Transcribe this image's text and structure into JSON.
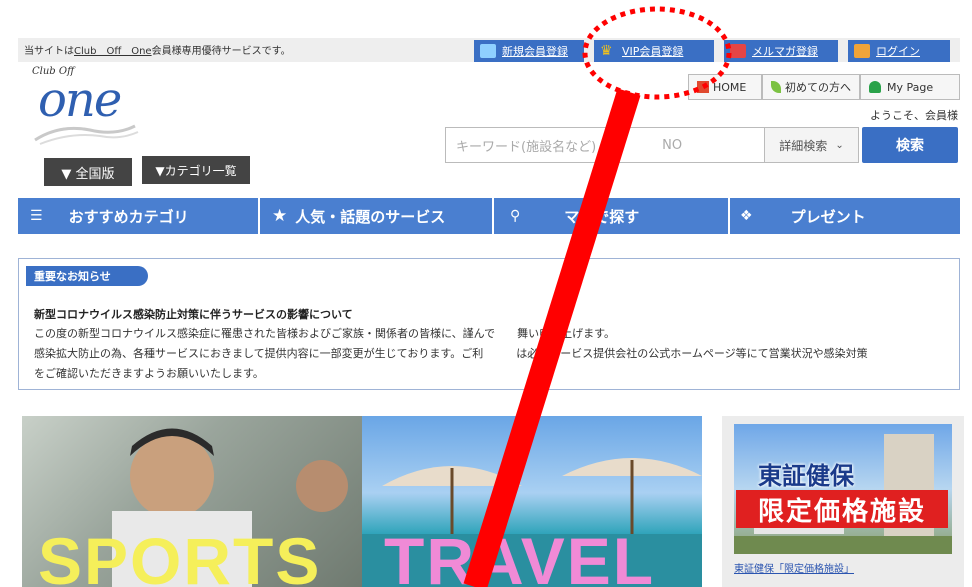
{
  "top": {
    "note_prefix": "当サイトは",
    "note_link": "Club　Off　One",
    "note_suffix": "会員様専用優待サービスです。",
    "links": [
      {
        "label": "新規会員登録",
        "icon": "new-member-icon",
        "color": "#8fd0ff"
      },
      {
        "label": "VIP会員登録",
        "icon": "crown-icon",
        "color": "#f2c21b"
      },
      {
        "label": "メルマガ登録",
        "icon": "mail-icon",
        "color": "#e54545"
      },
      {
        "label": "ログイン",
        "icon": "lock-icon",
        "color": "#f0a43a"
      }
    ]
  },
  "logo": {
    "small": "Club Off",
    "big": "one"
  },
  "region_button": "▼ 全国版",
  "category_button": "▼カテゴリ一覧",
  "util": {
    "home": "HOME",
    "first_time": "初めての方へ",
    "my_page": "My Page",
    "welcome": "ようこそ、会員様"
  },
  "search": {
    "placeholder": "キーワード(施設名など)",
    "placeholder_tail": "NO",
    "detail_label": "詳細検索",
    "button_label": "検索"
  },
  "nav": [
    {
      "label": "おすすめカテゴリ",
      "icon": "list-icon"
    },
    {
      "label": "人気・話題のサービス",
      "icon": "star-icon"
    },
    {
      "label": "マ　で探す",
      "icon": "map-pin-icon"
    },
    {
      "label": "プレゼント",
      "icon": "gift-icon"
    }
  ],
  "notice": {
    "tag": "重要なお知らせ",
    "title": "新型コロナウイルス感染防止対策に伴うサービスの影響について",
    "line1": "この度の新型コロナウイルス感染症に罹患された皆様およびご家族・関係者の皆様に、謹んで　　舞い申し上げます。",
    "line2": "感染拡大防止の為、各種サービスにおきまして提供内容に一部変更が生じております。ご利　　　は必ずサービス提供会社の公式ホームページ等にて営業状況や感染対策",
    "line3": "をご確認いただきますようお願いいたします。"
  },
  "banners": {
    "sports": "SPORTS",
    "travel": "TRAVEL"
  },
  "side": {
    "title": "東証健保",
    "subtitle": "限定価格施設",
    "caption": "東証健保「限定価格施設」"
  },
  "colors": {
    "brand_blue": "#3a6fc4",
    "nav_blue": "#4a7fd0",
    "annotation_red": "#ff0000"
  }
}
